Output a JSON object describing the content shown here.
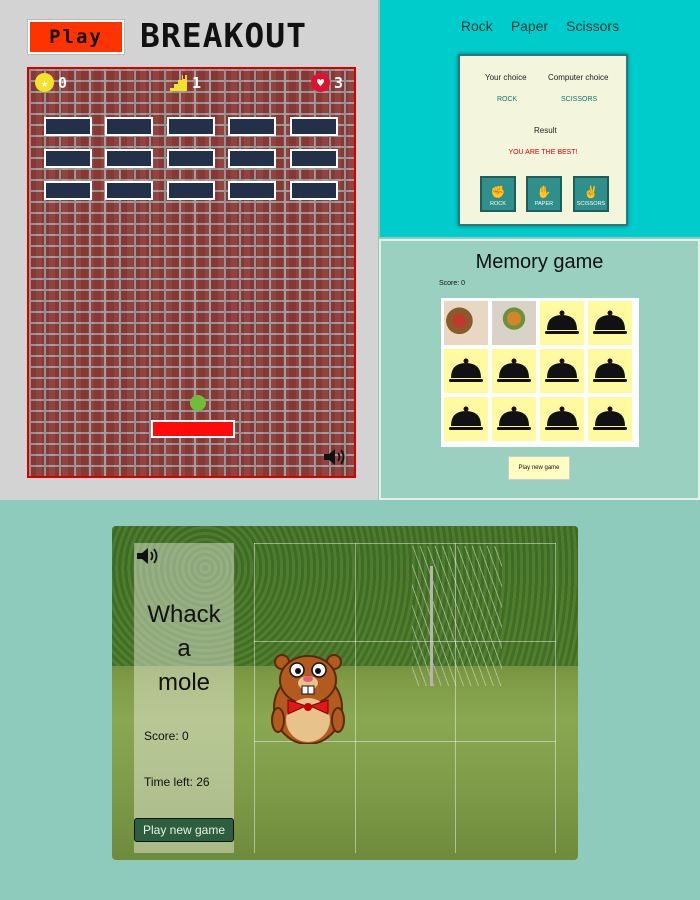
{
  "breakout": {
    "play_label": "Play",
    "title": "BREAKOUT",
    "hud": {
      "score": "0",
      "level": "1",
      "lives": "3"
    },
    "colors": {
      "play": "#ff3300",
      "paddle": "#ff0a0a",
      "ball": "#6fbe3a",
      "brick": "#22304a"
    },
    "icons": [
      "star-icon",
      "stairs-icon",
      "heart-icon",
      "speaker-icon"
    ]
  },
  "rps": {
    "nav": [
      "Rock",
      "Paper",
      "Scissors"
    ],
    "your_choice_label": "Your choice",
    "computer_choice_label": "Computer choice",
    "your_choice": "ROCK",
    "computer_choice": "SCISSORS",
    "result_label": "Result",
    "result": "YOU ARE THE BEST!",
    "buttons": [
      "ROCK",
      "PAPER",
      "SCISSORS"
    ]
  },
  "memory": {
    "title": "Memory  game",
    "score": "Score:  0",
    "new_game": "Play new game",
    "cards": [
      "food-photo",
      "food-photo",
      "cloche-icon",
      "cloche-icon",
      "cloche-icon",
      "cloche-icon",
      "cloche-icon",
      "cloche-icon",
      "cloche-icon",
      "cloche-icon",
      "cloche-icon",
      "cloche-icon"
    ]
  },
  "whack": {
    "title_line1": "Whack",
    "title_line2": "a",
    "title_line3": "mole",
    "score": "Score: 0",
    "time_left": "Time left: 26",
    "new_game": "Play new game"
  }
}
